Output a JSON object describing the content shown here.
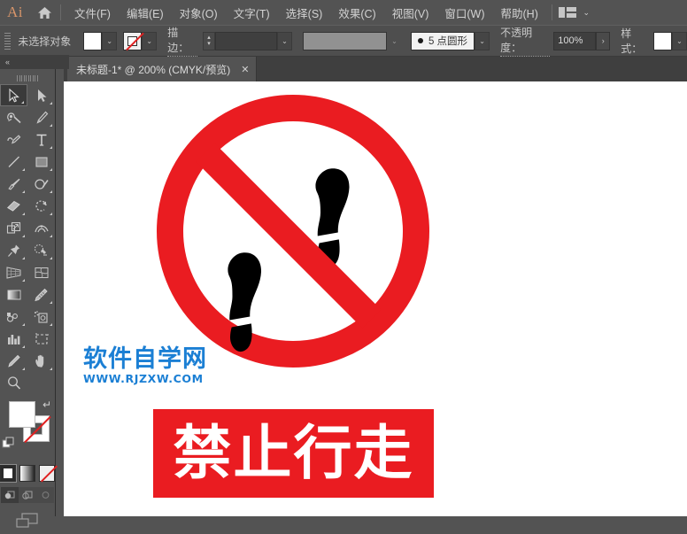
{
  "app": {
    "logo_text": "Ai",
    "home_icon": "home-icon",
    "workspace_icon": "workspace-switcher-icon",
    "workspace_chevron": "⌄"
  },
  "menubar": {
    "items": [
      {
        "label": "文件(F)",
        "name": "menu-file"
      },
      {
        "label": "编辑(E)",
        "name": "menu-edit"
      },
      {
        "label": "对象(O)",
        "name": "menu-object"
      },
      {
        "label": "文字(T)",
        "name": "menu-type"
      },
      {
        "label": "选择(S)",
        "name": "menu-select"
      },
      {
        "label": "效果(C)",
        "name": "menu-effect"
      },
      {
        "label": "视图(V)",
        "name": "menu-view"
      },
      {
        "label": "窗口(W)",
        "name": "menu-window"
      },
      {
        "label": "帮助(H)",
        "name": "menu-help"
      }
    ]
  },
  "controlbar": {
    "selection_status": "未选择对象",
    "fill_swatch_color": "#ffffff",
    "stroke_swatch": "none",
    "stroke_label": "描边：",
    "stroke_weight_value": "",
    "stroke_profile_value": "",
    "brush_label": "5 点圆形",
    "opacity_label": "不透明度：",
    "opacity_value": "100%",
    "style_label": "样式：",
    "style_swatch_color": "#ffffff",
    "chevron": "⌄",
    "chevron_right": "›"
  },
  "document_tab": {
    "title": "未标题-1* @ 200% (CMYK/预览)",
    "close_glyph": "✕"
  },
  "toolbar": {
    "collapse_glyph": "«",
    "tools": [
      {
        "name": "selection-tool",
        "active": true
      },
      {
        "name": "direct-selection-tool",
        "active": false
      },
      {
        "name": "magic-wand-tool",
        "active": false
      },
      {
        "name": "pen-tool",
        "active": false
      },
      {
        "name": "curvature-tool",
        "active": false
      },
      {
        "name": "type-tool",
        "active": false
      },
      {
        "name": "line-segment-tool",
        "active": false
      },
      {
        "name": "rectangle-tool",
        "active": false
      },
      {
        "name": "paintbrush-tool",
        "active": false
      },
      {
        "name": "shaper-tool",
        "active": false
      },
      {
        "name": "eraser-tool",
        "active": false
      },
      {
        "name": "rotate-tool",
        "active": false
      },
      {
        "name": "scale-tool",
        "active": false
      },
      {
        "name": "width-tool",
        "active": false
      },
      {
        "name": "free-transform-tool",
        "active": false
      },
      {
        "name": "shape-builder-tool",
        "active": false
      },
      {
        "name": "perspective-grid-tool",
        "active": false
      },
      {
        "name": "mesh-tool",
        "active": false
      },
      {
        "name": "gradient-tool",
        "active": false
      },
      {
        "name": "eyedropper-tool",
        "active": false
      },
      {
        "name": "blend-tool",
        "active": false
      },
      {
        "name": "symbol-sprayer-tool",
        "active": false
      },
      {
        "name": "column-graph-tool",
        "active": false
      },
      {
        "name": "artboard-tool",
        "active": false
      },
      {
        "name": "slice-tool",
        "active": false
      },
      {
        "name": "hand-tool",
        "active": false
      },
      {
        "name": "zoom-tool",
        "active": false
      }
    ],
    "fill_color": "#ffffff",
    "stroke_color": "#ffffff",
    "fill_stroke_modes": [
      "solid-color-mode",
      "gradient-mode",
      "none-mode"
    ],
    "drawing_modes": [
      "draw-normal",
      "draw-behind",
      "draw-inside"
    ],
    "screen_mode": "change-screen-mode"
  },
  "canvas": {
    "artwork_name": "no-walking-sign",
    "prohibition_color": "#ea1c21",
    "footprint_color": "#000000",
    "banner_background": "#ea1c21",
    "banner_text": "禁止行走",
    "banner_text_color": "#ffffff",
    "watermark": {
      "cn": "软件自学网",
      "en": "WWW.RJZXW.COM",
      "color": "#1b7fd4"
    }
  }
}
